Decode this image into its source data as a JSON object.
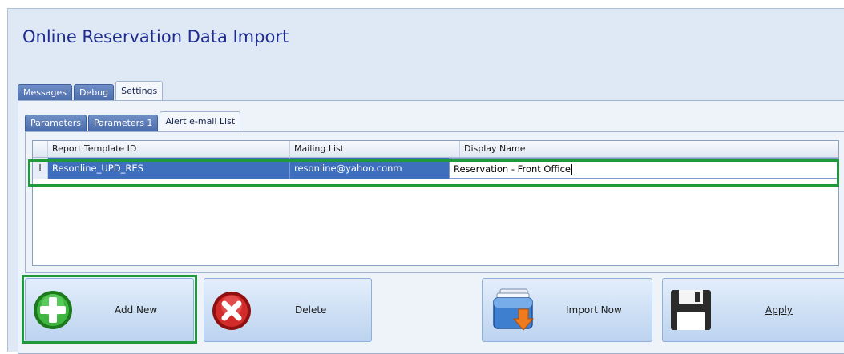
{
  "window": {
    "title": "Online Reservation Data Import"
  },
  "tabs": {
    "main": [
      "Messages",
      "Debug",
      "Settings"
    ],
    "sub": [
      "Parameters",
      "Parameters 1",
      "Alert e-mail List"
    ]
  },
  "grid": {
    "columns": [
      "Report Template ID",
      "Mailing List",
      "Display Name"
    ],
    "rows": [
      {
        "indicator": "I",
        "report_template_id": "Resonline_UPD_RES",
        "mailing_list": "resonline@yahoo.conm",
        "display_name": "Reservation - Front Office"
      }
    ]
  },
  "buttons": {
    "add_new": "Add New",
    "delete": "Delete",
    "import_now": "Import Now",
    "apply": "Apply"
  },
  "colors": {
    "title": "#1e2c8e",
    "highlight": "#1f9a3a",
    "selection": "#3d6fbd"
  },
  "icons": {
    "add_new": "plus-circle-icon",
    "delete": "x-circle-icon",
    "import_now": "import-icon",
    "apply": "floppy-disk-icon"
  }
}
